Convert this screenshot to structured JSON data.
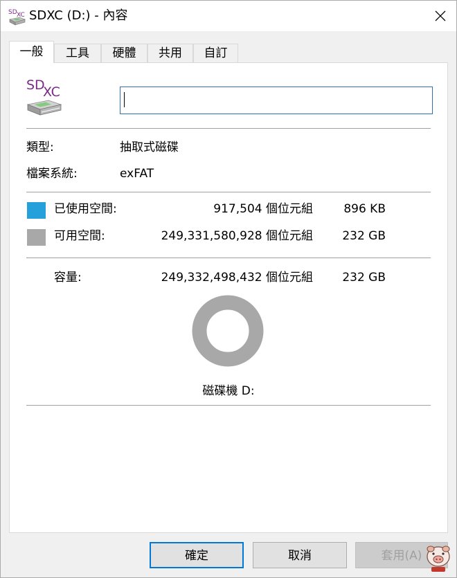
{
  "window": {
    "title": "SDXC (D:) - 內容"
  },
  "tabs": [
    {
      "label": "一般",
      "active": true
    },
    {
      "label": "工具",
      "active": false
    },
    {
      "label": "硬體",
      "active": false
    },
    {
      "label": "共用",
      "active": false
    },
    {
      "label": "自訂",
      "active": false
    }
  ],
  "drive": {
    "icon": "sdxc-drive-icon",
    "icon_text_sd": "SD",
    "icon_text_xc": "XC",
    "name_value": "",
    "type_label": "類型:",
    "type_value": "抽取式磁碟",
    "fs_label": "檔案系統:",
    "fs_value": "exFAT"
  },
  "space": {
    "used": {
      "label": "已使用空間:",
      "bytes": "917,504 個位元組",
      "size": "896 KB",
      "color": "#26a0da"
    },
    "free": {
      "label": "可用空間:",
      "bytes": "249,331,580,928 個位元組",
      "size": "232 GB",
      "color": "#a8a8a8"
    },
    "capacity": {
      "label": "容量:",
      "bytes": "249,332,498,432 個位元組",
      "size": "232 GB"
    },
    "used_fraction": 3.7e-06,
    "drive_label": "磁碟機 D:"
  },
  "buttons": {
    "ok": "確定",
    "cancel": "取消",
    "apply": "套用(A)"
  },
  "colors": {
    "accent": "#0078d7",
    "donut_free": "#a8a8a8"
  }
}
